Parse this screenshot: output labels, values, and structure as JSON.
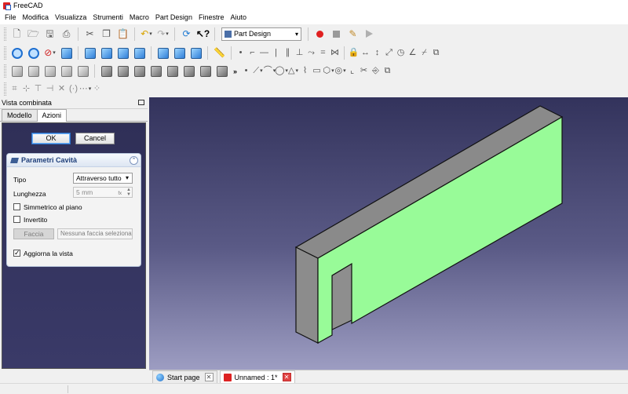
{
  "window": {
    "title": "FreeCAD"
  },
  "menu": [
    "File",
    "Modifica",
    "Visualizza",
    "Strumenti",
    "Macro",
    "Part Design",
    "Finestre",
    "Aiuto"
  ],
  "toolbar": {
    "workbench": "Part Design",
    "icons_row1": [
      "new-document-icon",
      "open-icon",
      "save-icon",
      "save-as-icon",
      "cut-icon",
      "copy-icon",
      "paste-icon",
      "undo-icon",
      "redo-icon",
      "refresh-icon",
      "whats-this-icon"
    ],
    "macro_icons": [
      "record-macro-icon",
      "stop-macro-icon",
      "edit-macro-icon",
      "run-macro-icon"
    ],
    "overflow_label": "»"
  },
  "combo_view": {
    "title": "Vista combinata",
    "tabs": [
      "Modello",
      "Azioni"
    ],
    "active_tab": "Azioni",
    "ok_label": "OK",
    "cancel_label": "Cancel"
  },
  "pocket_params": {
    "title": "Parametri Cavità",
    "type_label": "Tipo",
    "type_value": "Attraverso tutto",
    "length_label": "Lunghezza",
    "length_value": "5 mm",
    "symmetric_label": "Simmetrico al piano",
    "symmetric_checked": false,
    "reversed_label": "Invertito",
    "reversed_checked": false,
    "face_button": "Faccia",
    "face_value": "Nessuna faccia selezionata",
    "update_view_label": "Aggiorna la vista",
    "update_view_checked": true
  },
  "doc_tabs": [
    {
      "label": "Start page",
      "active": false
    },
    {
      "label": "Unnamed : 1*",
      "active": true
    }
  ],
  "colors": {
    "face_green": "#98fb98",
    "body_grey": "#8a8a8a",
    "view_top": "#33335c",
    "view_bottom": "#9d9dc2",
    "panel_header": "#1f3f7a"
  }
}
